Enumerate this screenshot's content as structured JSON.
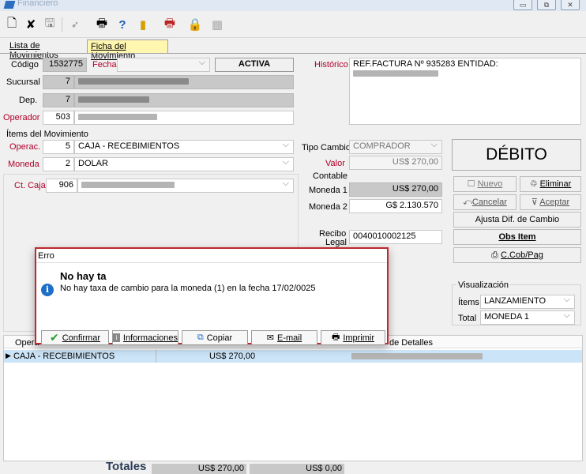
{
  "window": {
    "title": "Financiero"
  },
  "tabs": [
    {
      "label": "Lista de Movimientos"
    },
    {
      "label": "Ficha del Movimiento"
    }
  ],
  "form": {
    "codigo_label": "Código",
    "codigo_value": "1532775",
    "fecha_label": "Fecha",
    "fecha_value": "",
    "status": "ACTIVA",
    "historico_label": "Histórico",
    "historico_value": "REF.FACTURA Nº 935283 ENTIDAD:",
    "sucursal_label": "Sucursal",
    "sucursal_value": "7",
    "dep_label": "Dep.",
    "dep_value": "7",
    "operador_label": "Operador",
    "operador_value": "503",
    "items_label": "Ítems del Movimiento",
    "operac_label": "Operac.",
    "operac_code": "5",
    "operac_value": "CAJA - RECEBIMIENTOS",
    "moneda_label": "Moneda",
    "moneda_code": "2",
    "moneda_value": "DOLAR",
    "ctcaja_label": "Ct. Caja",
    "ctcaja_code": "906",
    "tipo_cambio_label": "Tipo Cambio",
    "tipo_cambio_value": "COMPRADOR",
    "valor_label": "Valor",
    "valor_value": "US$ 270,00",
    "contable_label": "Contable",
    "moneda1_label": "Moneda 1",
    "moneda1_value": "US$ 270,00",
    "moneda2_label": "Moneda 2",
    "moneda2_value": "G$ 2.130.570",
    "recibo_label": "Recibo",
    "legal_label": "Legal",
    "recibo_value": "0040010002125"
  },
  "side": {
    "debito": "DÉBITO",
    "nuevo": "Nuevo",
    "eliminar": "Eliminar",
    "cancelar": "Cancelar",
    "aceptar": "Aceptar",
    "ajusta": "Ajusta Dif. de Cambio",
    "obs_item": "Obs Item",
    "ccob": "C.Cob/Pag",
    "visualizacion": "Visualización",
    "items_label": "Ítems",
    "items_value": "LANZAMIENTO",
    "total_label": "Total",
    "total_value": "MONEDA 1"
  },
  "table": {
    "col_operac": "Opera",
    "col_detalles": "de Detalles",
    "rows": [
      {
        "operacion": "CAJA - RECEBIMIENTOS",
        "valor": "US$ 270,00"
      }
    ]
  },
  "totals": {
    "label": "Totales",
    "value1": "US$ 270,00",
    "value2": "US$ 0,00"
  },
  "dialog": {
    "title": "Erro",
    "heading": "No hay ta",
    "message": "No hay taxa de cambio para la moneda (1) en la fecha 17/02/0025",
    "buttons": {
      "confirmar": "Confirmar",
      "informaciones": "Informaciones",
      "copiar": "Copiar",
      "email": "E-mail",
      "imprimir": "Imprimir"
    }
  },
  "colors": {
    "accent_red": "#c0282d",
    "selected_row": "#cce4f7",
    "tab_active": "#fff6b0"
  }
}
